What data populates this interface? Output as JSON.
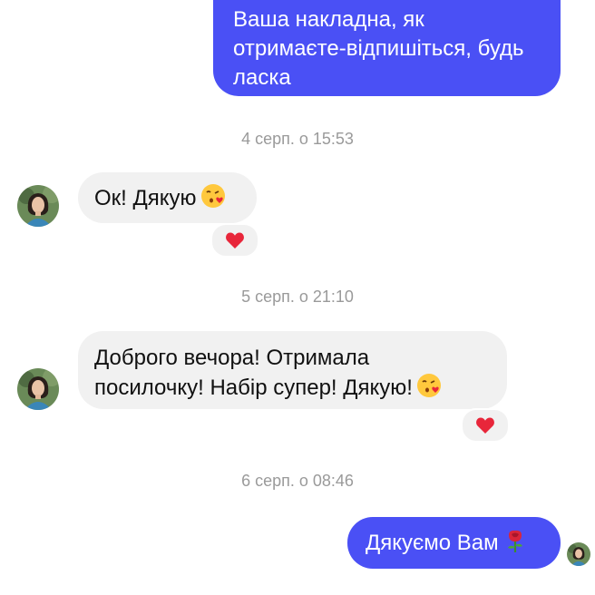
{
  "messages": {
    "m1": {
      "lines": [
        "Ваша накладна, як",
        "отримаєте-відпишіться, будь",
        "ласка"
      ]
    },
    "ts1": "4 серп. о 15:53",
    "m2": {
      "text": "Ок! Дякую",
      "emoji": "kissing-face-heart-icon",
      "reaction": "heart-icon"
    },
    "ts2": "5 серп. о 21:10",
    "m3": {
      "lines": [
        "Доброго вечора! Отримала",
        "посилочку! Набір супер! Дякую!"
      ],
      "emoji": "kissing-face-heart-icon",
      "reaction": "heart-icon"
    },
    "ts3": "6 серп. о 08:46",
    "m4": {
      "text": "Дякуємо Вам",
      "emoji": "rose-icon"
    }
  },
  "colors": {
    "outgoing_bubble": "#4a50f5",
    "incoming_bubble": "#f1f1f1",
    "timestamp": "#9a9a9a",
    "reaction_heart": "#e8263a"
  }
}
